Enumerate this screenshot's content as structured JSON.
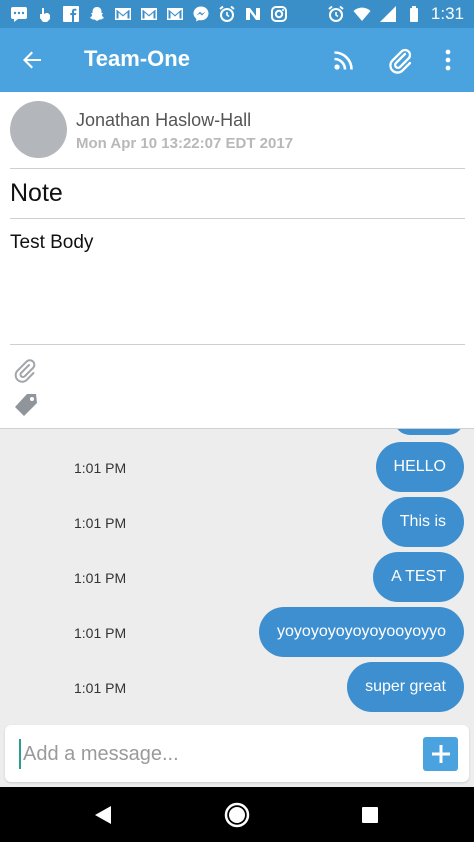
{
  "status_bar": {
    "time": "1:31",
    "left_icons": [
      "sms-icon",
      "hand-icon",
      "facebook-icon",
      "snapchat-icon",
      "gmail-icon",
      "gmail-icon",
      "gmail-icon",
      "messenger-icon",
      "alarm-icon",
      "n-icon",
      "instagram-icon"
    ],
    "right_icons": [
      "alarm-icon",
      "wifi-icon",
      "signal-icon",
      "battery-icon"
    ]
  },
  "app_bar": {
    "title": "Team-One",
    "icons": [
      "back-arrow-icon",
      "rss-feed-icon",
      "attachment-icon",
      "overflow-menu-icon"
    ],
    "color": "#4aa3df"
  },
  "note": {
    "author": "Jonathan Haslow-Hall",
    "date": "Mon Apr 10 13:22:07 EDT 2017",
    "title": "Note",
    "body": "Test Body",
    "icons": [
      "attachment-icon",
      "tag-icon"
    ]
  },
  "messages": [
    {
      "time": "1:01 PM",
      "text": "HELLO"
    },
    {
      "time": "1:01 PM",
      "text": "This is"
    },
    {
      "time": "1:01 PM",
      "text": "A TEST"
    },
    {
      "time": "1:01 PM",
      "text": "yoyoyoyoyoyoyooyoyyo"
    },
    {
      "time": "1:01 PM",
      "text": "super great"
    }
  ],
  "composer": {
    "placeholder": "Add a message...",
    "send_icon": "plus-icon"
  },
  "nav_bar": {
    "icons": [
      "back-triangle-icon",
      "home-circle-icon",
      "recents-square-icon"
    ]
  },
  "colors": {
    "status_bar": "#3a8fc8",
    "accent": "#4aa3df",
    "bubble": "#3d8fcf"
  }
}
